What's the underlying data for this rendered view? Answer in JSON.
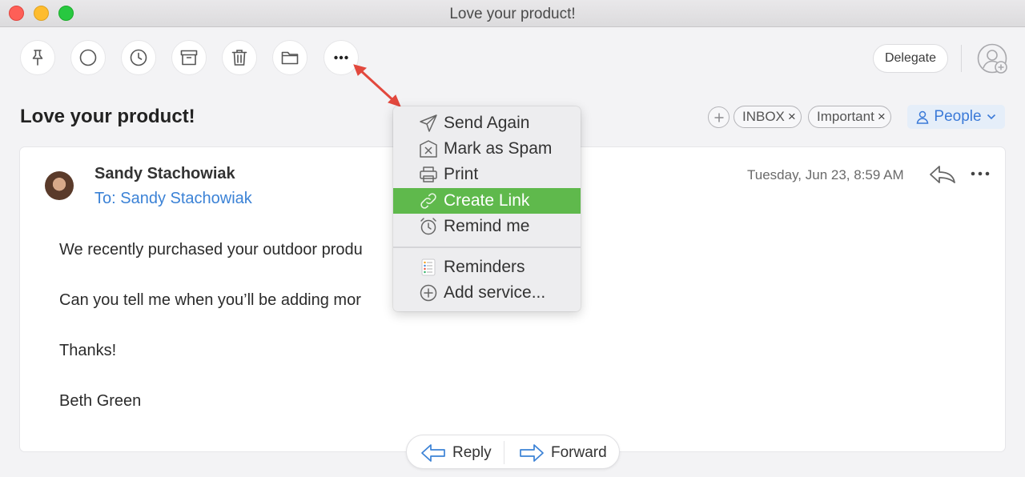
{
  "window": {
    "title": "Love your product!"
  },
  "toolbar": {
    "buttons": [
      {
        "icon": "pin-icon"
      },
      {
        "icon": "circle-icon"
      },
      {
        "icon": "clock-icon"
      },
      {
        "icon": "archive-icon"
      },
      {
        "icon": "trash-icon"
      },
      {
        "icon": "folder-icon"
      },
      {
        "icon": "more-icon"
      }
    ],
    "delegate_label": "Delegate",
    "add_person_icon": "add-person-icon"
  },
  "subject": "Love your product!",
  "tags": {
    "items": [
      {
        "label": "INBOX"
      },
      {
        "label": "Important"
      }
    ],
    "remove_glyph": "×",
    "people_label": "People"
  },
  "message": {
    "sender": "Sandy Stachowiak",
    "recipient": "To: Sandy Stachowiak",
    "datetime": "Tuesday, Jun 23, 8:59 AM",
    "body": [
      "We recently purchased your outdoor produ",
      "Can you tell me when you’ll be adding mor",
      "Thanks!",
      "Beth Green"
    ]
  },
  "actions": {
    "reply_label": "Reply",
    "forward_label": "Forward"
  },
  "menu": {
    "items": [
      {
        "label": "Send Again",
        "icon": "paper-plane-icon"
      },
      {
        "label": "Mark as Spam",
        "icon": "spam-icon"
      },
      {
        "label": "Print",
        "icon": "printer-icon"
      },
      {
        "label": "Create Link",
        "icon": "link-icon",
        "highlighted": true
      },
      {
        "label": "Remind me",
        "icon": "alarm-clock-icon"
      }
    ],
    "services": [
      {
        "label": "Reminders",
        "icon": "reminders-icon"
      },
      {
        "label": "Add service...",
        "icon": "plus-circle-icon"
      }
    ]
  },
  "colors": {
    "accent_blue": "#3b82d6",
    "highlight_green": "#5fb94c",
    "annotation_red": "#e2483d"
  }
}
